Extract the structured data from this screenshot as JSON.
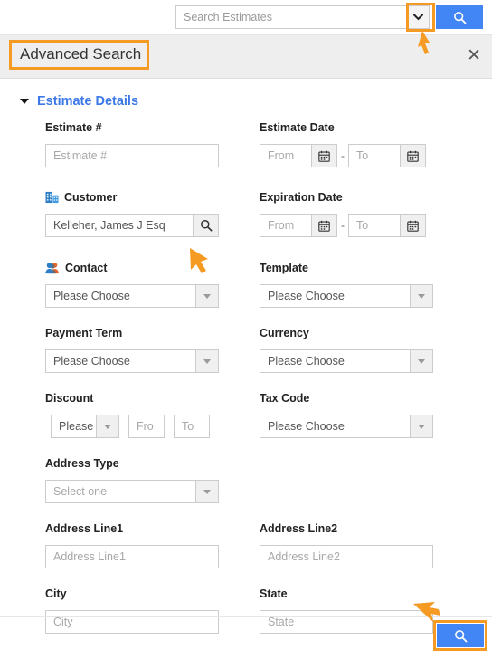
{
  "search_bar": {
    "placeholder": "Search Estimates",
    "value": "",
    "dropdown_icon": "chevron-down-icon",
    "search_icon": "search-icon"
  },
  "header": {
    "title": "Advanced Search",
    "close_icon": "close-icon"
  },
  "section": {
    "title": "Estimate Details",
    "expanded": true,
    "chevron_icon": "chevron-down-icon",
    "accent_color": "#3c78e8"
  },
  "fields": {
    "estimate_number": {
      "label": "Estimate #",
      "placeholder": "Estimate #",
      "value": ""
    },
    "estimate_date": {
      "label": "Estimate Date",
      "from_placeholder": "From",
      "from_value": "",
      "to_placeholder": "To",
      "to_value": "",
      "separator": "-",
      "calendar_icon": "calendar-icon"
    },
    "customer": {
      "label": "Customer",
      "icon": "company-building-icon",
      "value": "Kelleher, James J Esq",
      "lookup_icon": "search-icon"
    },
    "expiration_date": {
      "label": "Expiration Date",
      "from_placeholder": "From",
      "from_value": "",
      "to_placeholder": "To",
      "to_value": "",
      "separator": "-",
      "calendar_icon": "calendar-icon"
    },
    "contact": {
      "label": "Contact",
      "icon": "contacts-people-icon",
      "value": "Please Choose"
    },
    "template": {
      "label": "Template",
      "value": "Please Choose"
    },
    "payment_term": {
      "label": "Payment Term",
      "value": "Please Choose"
    },
    "currency": {
      "label": "Currency",
      "value": "Please Choose"
    },
    "discount": {
      "label": "Discount",
      "type_value": "Please C",
      "from_placeholder": "Fro",
      "from_value": "",
      "to_placeholder": "To",
      "to_value": ""
    },
    "tax_code": {
      "label": "Tax Code",
      "value": "Please Choose"
    },
    "address_type": {
      "label": "Address Type",
      "placeholder": "Select one",
      "value": ""
    },
    "address_line1": {
      "label": "Address Line1",
      "placeholder": "Address Line1",
      "value": ""
    },
    "address_line2": {
      "label": "Address Line2",
      "placeholder": "Address Line2",
      "value": ""
    },
    "city": {
      "label": "City",
      "placeholder": "City",
      "value": ""
    },
    "state": {
      "label": "State",
      "placeholder": "State",
      "value": ""
    }
  },
  "bottom_search_button": {
    "icon": "search-icon"
  },
  "annotations": {
    "highlight_color": "#f59a23",
    "items": [
      "search-dropdown-caret",
      "advanced-search-title",
      "bottom-search-button"
    ]
  }
}
